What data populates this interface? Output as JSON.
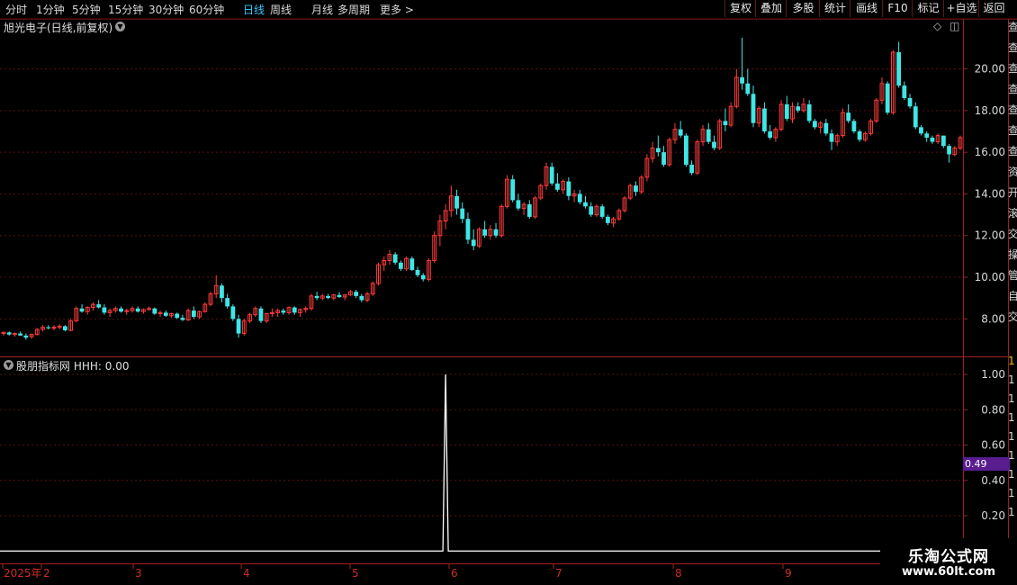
{
  "toolbar": {
    "periods": [
      "分时",
      "1分钟",
      "5分钟",
      "15分钟",
      "30分钟",
      "60分钟",
      "日线",
      "周线",
      "月线",
      "多周期",
      "更多 >"
    ],
    "active_period": "日线",
    "right_buttons": [
      "复权",
      "叠加",
      "多股",
      "统计",
      "画线",
      "F10",
      "标记",
      "+自选",
      "返回"
    ]
  },
  "stock": {
    "title": "旭光电子(日线,前复权)"
  },
  "indicator": {
    "title": "股朋指标网  HHH: 0.00"
  },
  "side_badge": {
    "value": "0.49"
  },
  "watermark": {
    "line1": "乐淘公式网",
    "line2": "www.60lt.com"
  },
  "side_strip": {
    "chars": [
      "查",
      "查",
      "查",
      "查",
      "查",
      "查",
      "查",
      "资",
      "开",
      "滚",
      "交",
      "操",
      "管",
      "自",
      "交",
      "1",
      "1",
      "1",
      "1",
      "1",
      "1",
      "1",
      "1",
      "1"
    ]
  },
  "colors": {
    "up": "#ff3b3b",
    "down": "#3fe6e6",
    "grid": "#5a0f0f",
    "axis": "#a01f1f",
    "indicator_line": "#ffffff",
    "active_tab": "#37c8ff"
  },
  "chart_data": [
    {
      "type": "candlestick",
      "title": "旭光电子(日线,前复权)",
      "y_ticks": [
        "20.00",
        "18.00",
        "16.00",
        "14.00",
        "12.00",
        "10.00",
        "8.00"
      ],
      "ylim": [
        6.2,
        22.4
      ],
      "x_ticks": [
        "2025年",
        "2",
        "3",
        "4",
        "5",
        "6",
        "7",
        "8",
        "9"
      ],
      "grid": true,
      "candles": [
        [
          7.3,
          7.4,
          7.2,
          7.35
        ],
        [
          7.35,
          7.4,
          7.2,
          7.25
        ],
        [
          7.25,
          7.35,
          7.15,
          7.3
        ],
        [
          7.3,
          7.4,
          7.2,
          7.2
        ],
        [
          7.2,
          7.3,
          7.0,
          7.1
        ],
        [
          7.15,
          7.3,
          7.05,
          7.25
        ],
        [
          7.25,
          7.55,
          7.2,
          7.5
        ],
        [
          7.5,
          7.7,
          7.4,
          7.6
        ],
        [
          7.6,
          7.7,
          7.5,
          7.55
        ],
        [
          7.55,
          7.7,
          7.45,
          7.6
        ],
        [
          7.6,
          7.75,
          7.5,
          7.65
        ],
        [
          7.65,
          7.7,
          7.4,
          7.45
        ],
        [
          7.45,
          8.0,
          7.4,
          7.9
        ],
        [
          7.9,
          8.6,
          7.85,
          8.5
        ],
        [
          8.5,
          8.7,
          8.3,
          8.35
        ],
        [
          8.35,
          8.6,
          8.2,
          8.55
        ],
        [
          8.55,
          8.8,
          8.4,
          8.7
        ],
        [
          8.7,
          8.9,
          8.5,
          8.55
        ],
        [
          8.55,
          8.7,
          8.2,
          8.3
        ],
        [
          8.3,
          8.5,
          8.1,
          8.4
        ],
        [
          8.4,
          8.6,
          8.3,
          8.5
        ],
        [
          8.5,
          8.6,
          8.3,
          8.35
        ],
        [
          8.35,
          8.5,
          8.2,
          8.4
        ],
        [
          8.4,
          8.6,
          8.3,
          8.5
        ],
        [
          8.5,
          8.6,
          8.3,
          8.35
        ],
        [
          8.35,
          8.5,
          8.25,
          8.45
        ],
        [
          8.45,
          8.6,
          8.4,
          8.5
        ],
        [
          8.5,
          8.55,
          8.2,
          8.25
        ],
        [
          8.25,
          8.4,
          8.1,
          8.3
        ],
        [
          8.3,
          8.4,
          8.1,
          8.15
        ],
        [
          8.15,
          8.3,
          8.05,
          8.25
        ],
        [
          8.25,
          8.3,
          8.0,
          8.05
        ],
        [
          8.05,
          8.2,
          7.9,
          7.95
        ],
        [
          7.95,
          8.5,
          7.9,
          8.4
        ],
        [
          8.4,
          8.6,
          8.0,
          8.1
        ],
        [
          8.1,
          8.4,
          8.0,
          8.35
        ],
        [
          8.35,
          8.8,
          8.3,
          8.7
        ],
        [
          8.7,
          9.3,
          8.6,
          9.2
        ],
        [
          9.2,
          10.1,
          9.0,
          9.6
        ],
        [
          9.6,
          9.7,
          8.8,
          9.0
        ],
        [
          9.0,
          9.2,
          8.5,
          8.6
        ],
        [
          8.6,
          8.7,
          7.9,
          8.0
        ],
        [
          8.0,
          8.2,
          7.1,
          7.3
        ],
        [
          7.3,
          8.0,
          7.2,
          7.9
        ],
        [
          7.9,
          8.3,
          7.8,
          8.2
        ],
        [
          8.2,
          8.6,
          8.1,
          8.5
        ],
        [
          8.5,
          8.6,
          7.8,
          7.9
        ],
        [
          7.9,
          8.3,
          7.8,
          8.25
        ],
        [
          8.25,
          8.5,
          8.1,
          8.3
        ],
        [
          8.3,
          8.5,
          8.1,
          8.4
        ],
        [
          8.4,
          8.5,
          8.2,
          8.3
        ],
        [
          8.3,
          8.6,
          8.2,
          8.55
        ],
        [
          8.55,
          8.6,
          8.2,
          8.3
        ],
        [
          8.3,
          8.5,
          8.1,
          8.45
        ],
        [
          8.45,
          8.6,
          8.3,
          8.5
        ],
        [
          8.5,
          9.2,
          8.4,
          9.1
        ],
        [
          9.1,
          9.3,
          8.9,
          9.0
        ],
        [
          9.0,
          9.2,
          8.9,
          9.1
        ],
        [
          9.1,
          9.2,
          8.95,
          9.0
        ],
        [
          9.0,
          9.2,
          8.9,
          9.15
        ],
        [
          9.15,
          9.3,
          9.0,
          9.05
        ],
        [
          9.05,
          9.2,
          8.9,
          9.15
        ],
        [
          9.15,
          9.4,
          9.1,
          9.3
        ],
        [
          9.3,
          9.4,
          9.0,
          9.1
        ],
        [
          9.1,
          9.2,
          8.8,
          8.9
        ],
        [
          8.9,
          9.3,
          8.8,
          9.2
        ],
        [
          9.2,
          9.8,
          9.1,
          9.7
        ],
        [
          9.7,
          10.7,
          9.6,
          10.6
        ],
        [
          10.6,
          11.0,
          10.3,
          10.8
        ],
        [
          10.8,
          11.3,
          10.6,
          11.1
        ],
        [
          11.1,
          11.2,
          10.6,
          10.7
        ],
        [
          10.7,
          10.8,
          10.3,
          10.4
        ],
        [
          10.4,
          11.0,
          10.3,
          10.9
        ],
        [
          10.9,
          11.0,
          10.3,
          10.35
        ],
        [
          10.35,
          10.5,
          10.0,
          10.1
        ],
        [
          10.1,
          10.2,
          9.8,
          9.9
        ],
        [
          9.9,
          10.9,
          9.8,
          10.8
        ],
        [
          10.8,
          12.2,
          10.7,
          12.0
        ],
        [
          12.0,
          13.0,
          11.5,
          12.7
        ],
        [
          12.7,
          13.5,
          12.3,
          13.2
        ],
        [
          13.2,
          14.4,
          12.9,
          13.9
        ],
        [
          13.9,
          14.2,
          13.0,
          13.3
        ],
        [
          13.3,
          13.6,
          12.6,
          12.8
        ],
        [
          12.8,
          13.1,
          11.6,
          11.8
        ],
        [
          11.8,
          12.3,
          11.3,
          11.5
        ],
        [
          11.5,
          12.4,
          11.4,
          12.3
        ],
        [
          12.3,
          12.7,
          11.9,
          12.0
        ],
        [
          12.0,
          12.5,
          11.8,
          12.3
        ],
        [
          12.3,
          12.6,
          11.9,
          12.0
        ],
        [
          12.0,
          13.5,
          11.9,
          13.4
        ],
        [
          13.4,
          14.9,
          13.3,
          14.7
        ],
        [
          14.7,
          14.9,
          13.6,
          13.7
        ],
        [
          13.7,
          14.0,
          13.2,
          13.3
        ],
        [
          13.3,
          13.6,
          13.0,
          13.5
        ],
        [
          13.5,
          13.7,
          12.8,
          12.9
        ],
        [
          12.9,
          13.9,
          12.8,
          13.8
        ],
        [
          13.8,
          14.5,
          13.7,
          14.4
        ],
        [
          14.4,
          15.5,
          14.2,
          15.3
        ],
        [
          15.3,
          15.5,
          14.4,
          14.5
        ],
        [
          14.5,
          15.0,
          14.1,
          14.2
        ],
        [
          14.2,
          14.7,
          14.0,
          14.6
        ],
        [
          14.6,
          14.8,
          13.7,
          13.9
        ],
        [
          13.9,
          14.2,
          13.6,
          14.0
        ],
        [
          14.0,
          14.2,
          13.5,
          13.6
        ],
        [
          13.6,
          13.9,
          13.3,
          13.4
        ],
        [
          13.4,
          13.6,
          12.9,
          13.0
        ],
        [
          13.0,
          13.5,
          12.9,
          13.4
        ],
        [
          13.4,
          13.5,
          12.8,
          12.9
        ],
        [
          12.9,
          13.0,
          12.5,
          12.6
        ],
        [
          12.6,
          12.9,
          12.4,
          12.8
        ],
        [
          12.8,
          13.3,
          12.7,
          13.2
        ],
        [
          13.2,
          13.9,
          13.1,
          13.8
        ],
        [
          13.8,
          14.5,
          13.7,
          14.4
        ],
        [
          14.4,
          14.6,
          13.9,
          14.1
        ],
        [
          14.1,
          14.9,
          14.0,
          14.8
        ],
        [
          14.8,
          15.9,
          14.6,
          15.7
        ],
        [
          15.7,
          16.5,
          15.5,
          16.2
        ],
        [
          16.2,
          16.8,
          15.8,
          16.0
        ],
        [
          16.0,
          16.3,
          15.3,
          15.4
        ],
        [
          15.4,
          16.7,
          15.3,
          16.6
        ],
        [
          16.6,
          17.4,
          16.4,
          17.1
        ],
        [
          17.1,
          17.5,
          16.7,
          16.8
        ],
        [
          16.8,
          16.9,
          15.3,
          15.4
        ],
        [
          15.4,
          15.6,
          14.9,
          15.0
        ],
        [
          15.0,
          16.6,
          14.9,
          16.5
        ],
        [
          16.5,
          17.3,
          16.3,
          17.1
        ],
        [
          17.1,
          17.4,
          16.4,
          16.5
        ],
        [
          16.5,
          16.8,
          16.1,
          16.2
        ],
        [
          16.2,
          17.6,
          16.1,
          17.5
        ],
        [
          17.5,
          18.1,
          17.0,
          17.3
        ],
        [
          17.3,
          18.4,
          17.2,
          18.2
        ],
        [
          18.2,
          20.0,
          18.1,
          19.6
        ],
        [
          19.6,
          21.5,
          19.0,
          19.3
        ],
        [
          19.3,
          20.0,
          18.7,
          18.8
        ],
        [
          18.8,
          19.2,
          17.2,
          17.4
        ],
        [
          17.4,
          18.2,
          17.2,
          18.1
        ],
        [
          18.1,
          18.4,
          16.9,
          17.0
        ],
        [
          17.0,
          17.3,
          16.6,
          16.7
        ],
        [
          16.7,
          17.2,
          16.5,
          17.1
        ],
        [
          17.1,
          18.5,
          17.0,
          18.3
        ],
        [
          18.3,
          18.7,
          17.5,
          17.6
        ],
        [
          17.6,
          18.4,
          17.4,
          18.2
        ],
        [
          18.2,
          18.4,
          17.9,
          18.0
        ],
        [
          18.0,
          18.6,
          17.9,
          18.3
        ],
        [
          18.3,
          18.5,
          17.4,
          17.5
        ],
        [
          17.5,
          17.6,
          17.1,
          17.2
        ],
        [
          17.2,
          17.5,
          16.9,
          17.4
        ],
        [
          17.4,
          17.6,
          16.8,
          16.9
        ],
        [
          16.9,
          17.1,
          16.1,
          16.5
        ],
        [
          16.5,
          16.9,
          16.3,
          16.8
        ],
        [
          16.8,
          18.1,
          16.7,
          17.9
        ],
        [
          17.9,
          18.3,
          17.4,
          17.5
        ],
        [
          17.5,
          17.6,
          16.9,
          17.0
        ],
        [
          17.0,
          17.1,
          16.5,
          16.6
        ],
        [
          16.6,
          17.0,
          16.5,
          16.9
        ],
        [
          16.9,
          17.6,
          16.8,
          17.5
        ],
        [
          17.5,
          18.6,
          17.4,
          18.5
        ],
        [
          18.5,
          19.6,
          18.3,
          19.3
        ],
        [
          19.3,
          19.4,
          17.8,
          17.9
        ],
        [
          17.9,
          20.9,
          17.8,
          20.8
        ],
        [
          20.8,
          21.3,
          19.1,
          19.2
        ],
        [
          19.2,
          19.4,
          18.5,
          18.6
        ],
        [
          18.6,
          18.8,
          18.1,
          18.2
        ],
        [
          18.2,
          18.4,
          17.1,
          17.2
        ],
        [
          17.2,
          17.3,
          16.8,
          16.9
        ],
        [
          16.9,
          17.0,
          16.5,
          16.7
        ],
        [
          16.7,
          16.8,
          16.4,
          16.5
        ],
        [
          16.5,
          16.9,
          16.4,
          16.8
        ],
        [
          16.8,
          16.8,
          16.2,
          16.3
        ],
        [
          16.3,
          16.4,
          15.5,
          15.9
        ],
        [
          15.9,
          16.3,
          15.8,
          16.2
        ],
        [
          16.2,
          16.8,
          16.1,
          16.7
        ]
      ]
    },
    {
      "type": "line",
      "title": "股朋指标网  HHH: 0.00",
      "y_ticks": [
        "1.00",
        "0.80",
        "0.60",
        "0.40",
        "0.20"
      ],
      "ylim": [
        -0.07,
        1.0
      ],
      "spike_index": 79,
      "series": [
        {
          "values_note": "",
          "values": []
        }
      ]
    }
  ]
}
